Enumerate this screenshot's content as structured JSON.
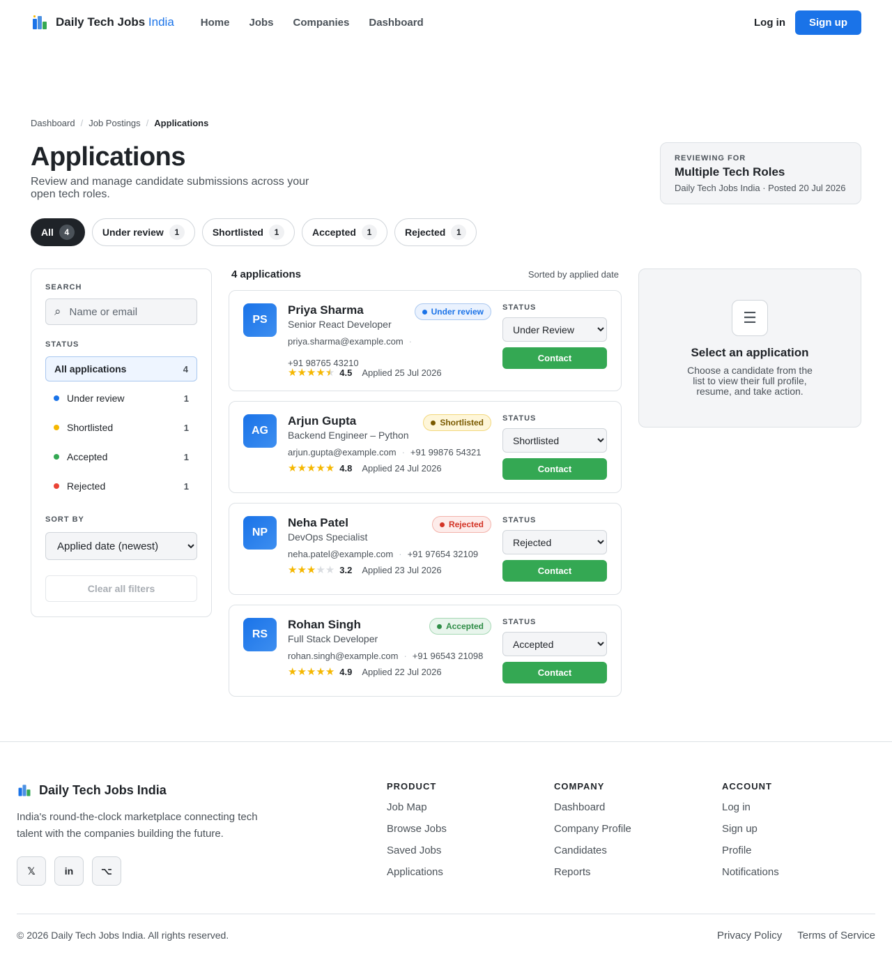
{
  "nav": {
    "brand_main": "Daily Tech Jobs",
    "brand_accent": "India",
    "links": [
      "Home",
      "Jobs",
      "Companies",
      "Dashboard"
    ],
    "login": "Log in",
    "signup": "Sign up"
  },
  "breadcrumb": [
    "Dashboard",
    "Job Postings",
    "Applications"
  ],
  "header": {
    "title": "Applications",
    "subtitle": "Review and manage candidate submissions across your open tech roles."
  },
  "reviewing": {
    "label": "REVIEWING FOR",
    "title": "Multiple Tech Roles",
    "meta": "Daily Tech Jobs India · Posted 20 Jul 2026"
  },
  "tabs": [
    {
      "label": "All",
      "count": "4"
    },
    {
      "label": "Under review",
      "count": "1"
    },
    {
      "label": "Shortlisted",
      "count": "1"
    },
    {
      "label": "Accepted",
      "count": "1"
    },
    {
      "label": "Rejected",
      "count": "1"
    }
  ],
  "sidebar": {
    "search_label": "SEARCH",
    "search_placeholder": "Name or email",
    "status_label": "STATUS",
    "statuses": [
      {
        "label": "All applications",
        "count": "4",
        "color": ""
      },
      {
        "label": "Under review",
        "count": "1",
        "color": "#1a73e8"
      },
      {
        "label": "Shortlisted",
        "count": "1",
        "color": "#f5b700"
      },
      {
        "label": "Accepted",
        "count": "1",
        "color": "#34a853"
      },
      {
        "label": "Rejected",
        "count": "1",
        "color": "#ea4335"
      }
    ],
    "sort_label": "SORT BY",
    "sort_value": "Applied date (newest)",
    "clear": "Clear all filters"
  },
  "list": {
    "count_label": "4 applications",
    "sort_note": "Sorted by applied date",
    "status_label": "STATUS",
    "contact_label": "Contact"
  },
  "applications": [
    {
      "initials": "PS",
      "name": "Priya Sharma",
      "role": "Senior React Developer",
      "email": "priya.sharma@example.com",
      "phone": "+91 98765 43210",
      "rating": "4.5",
      "stars": 4.5,
      "applied": "Applied 25 Jul 2026",
      "badge": "Under review",
      "status": "Under Review",
      "badge_bg": "#eaf2fe",
      "badge_border": "#a9c7ef",
      "badge_color": "#1a73e8"
    },
    {
      "initials": "AG",
      "name": "Arjun Gupta",
      "role": "Backend Engineer – Python",
      "email": "arjun.gupta@example.com",
      "phone": "+91 99876 54321",
      "rating": "4.8",
      "stars": 5,
      "applied": "Applied 24 Jul 2026",
      "badge": "Shortlisted",
      "status": "Shortlisted",
      "badge_bg": "#fef6d9",
      "badge_border": "#f2d77b",
      "badge_color": "#7a5a00"
    },
    {
      "initials": "NP",
      "name": "Neha Patel",
      "role": "DevOps Specialist",
      "email": "neha.patel@example.com",
      "phone": "+91 97654 32109",
      "rating": "3.2",
      "stars": 3,
      "applied": "Applied 23 Jul 2026",
      "badge": "Rejected",
      "status": "Rejected",
      "badge_bg": "#fdecea",
      "badge_border": "#f3b3ab",
      "badge_color": "#d33426"
    },
    {
      "initials": "RS",
      "name": "Rohan Singh",
      "role": "Full Stack Developer",
      "email": "rohan.singh@example.com",
      "phone": "+91 96543 21098",
      "rating": "4.9",
      "stars": 5,
      "applied": "Applied 22 Jul 2026",
      "badge": "Accepted",
      "status": "Accepted",
      "badge_bg": "#e8f5ec",
      "badge_border": "#a6d8b5",
      "badge_color": "#2f8d47"
    }
  ],
  "status_options": [
    "Under Review",
    "Shortlisted",
    "Accepted",
    "Rejected"
  ],
  "detail": {
    "icon": "list-icon",
    "title": "Select an application",
    "text": "Choose a candidate from the list to view their full profile, resume, and take action."
  },
  "footer": {
    "brand": "Daily Tech Jobs India",
    "tagline": "India's round-the-clock marketplace connecting tech talent with the companies building the future.",
    "socials": [
      "𝕏",
      "in",
      "⌥"
    ],
    "columns": [
      {
        "heading": "PRODUCT",
        "items": [
          "Job Map",
          "Browse Jobs",
          "Saved Jobs",
          "Applications"
        ]
      },
      {
        "heading": "COMPANY",
        "items": [
          "Dashboard",
          "Company Profile",
          "Candidates",
          "Reports"
        ]
      },
      {
        "heading": "ACCOUNT",
        "items": [
          "Log in",
          "Sign up",
          "Profile",
          "Notifications"
        ]
      }
    ],
    "copyright": "© 2026 Daily Tech Jobs India. All rights reserved.",
    "legal": [
      "Privacy Policy",
      "Terms of Service"
    ]
  }
}
